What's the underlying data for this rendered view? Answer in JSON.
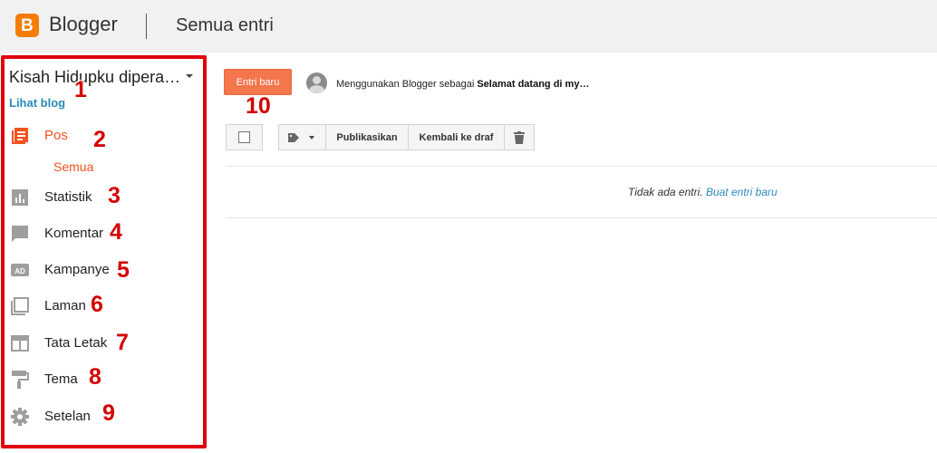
{
  "header": {
    "brand": "Blogger",
    "title": "Semua entri"
  },
  "sidebar": {
    "blog_name": "Kisah Hidupku dipera…",
    "view_blog": "Lihat blog",
    "items": [
      {
        "label": "Pos",
        "icon": "posts-icon",
        "active": true
      },
      {
        "label": "Statistik",
        "icon": "stats-icon"
      },
      {
        "label": "Komentar",
        "icon": "comment-icon"
      },
      {
        "label": "Kampanye",
        "icon": "ad-icon"
      },
      {
        "label": "Laman",
        "icon": "pages-icon"
      },
      {
        "label": "Tata Letak",
        "icon": "layout-icon"
      },
      {
        "label": "Tema",
        "icon": "paint-roller-icon"
      },
      {
        "label": "Setelan",
        "icon": "gear-icon"
      }
    ],
    "sub_item": "Semua"
  },
  "main": {
    "new_post_label": "Entri baru",
    "using_prefix": "Menggunakan Blogger sebagai ",
    "using_blog": "Selamat datang di my…",
    "toolbar": {
      "publish": "Publikasikan",
      "revert_draft": "Kembali ke draf"
    },
    "empty_text": "Tidak ada entri.",
    "empty_link": "Buat entri baru"
  },
  "annotations": [
    "1",
    "2",
    "3",
    "4",
    "5",
    "6",
    "7",
    "8",
    "9",
    "10"
  ],
  "colors": {
    "accent": "#f4511e",
    "frame": "#e0000b",
    "link": "#2b8bb7",
    "button": "#f4764c"
  }
}
